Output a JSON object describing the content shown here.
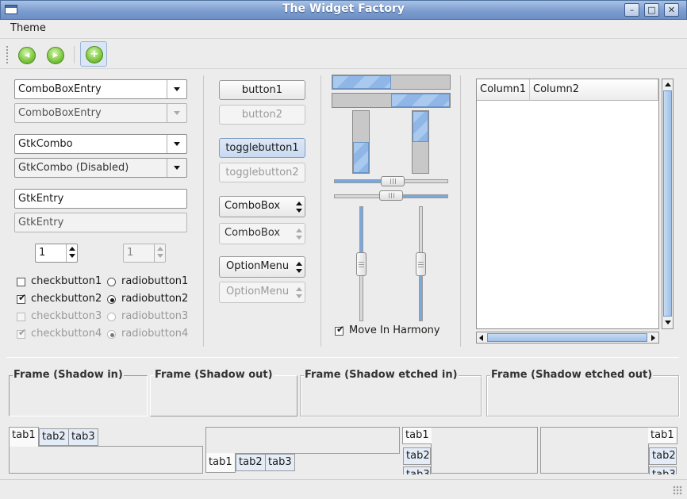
{
  "window": {
    "title": "The Widget Factory",
    "minimize": "–",
    "maximize": "□",
    "close": "✕"
  },
  "menu": {
    "theme": "Theme"
  },
  "toolbar": {
    "back_icon": "back-icon",
    "forward_icon": "forward-icon",
    "add_icon": "add-icon",
    "back_glyph": "◂",
    "forward_glyph": "▸",
    "add_glyph": "+"
  },
  "left": {
    "combo_entry_1": "ComboBoxEntry",
    "combo_entry_2": "ComboBoxEntry",
    "gtkcombo_1": "GtkCombo",
    "gtkcombo_2": "GtkCombo (Disabled)",
    "entry_1": "GtkEntry",
    "entry_2": "GtkEntry",
    "spin_1": "1",
    "spin_2": "1",
    "checks": [
      {
        "label": "checkbutton1",
        "checked": false,
        "disabled": false
      },
      {
        "label": "checkbutton2",
        "checked": true,
        "disabled": false
      },
      {
        "label": "checkbutton3",
        "checked": false,
        "disabled": true
      },
      {
        "label": "checkbutton4",
        "checked": true,
        "disabled": true
      }
    ],
    "radios": [
      {
        "label": "radiobutton1",
        "checked": false,
        "disabled": false
      },
      {
        "label": "radiobutton2",
        "checked": true,
        "disabled": false
      },
      {
        "label": "radiobutton3",
        "checked": false,
        "disabled": true
      },
      {
        "label": "radiobutton4",
        "checked": true,
        "disabled": true
      }
    ]
  },
  "buttons": {
    "button1": "button1",
    "button2": "button2",
    "toggle1": "togglebutton1",
    "toggle2": "togglebutton2",
    "combobox1": "ComboBox",
    "combobox2": "ComboBox",
    "option1": "OptionMenu",
    "option2": "OptionMenu"
  },
  "ranges": {
    "hprogress_1": 0.5,
    "hprogress_2": 0.5,
    "vprogress_1": 0.5,
    "vprogress_2": 0.5,
    "hscale_1": 0.5,
    "hscale_2": 0.5,
    "vscale_1": 0.5,
    "vscale_2": 0.5,
    "move_in_harmony": "Move In Harmony",
    "move_in_harmony_checked": true
  },
  "tree": {
    "columns": [
      "Column1",
      "Column2"
    ]
  },
  "frames": [
    "Frame (Shadow in)",
    "Frame (Shadow out)",
    "Frame (Shadow etched in)",
    "Frame (Shadow etched out)"
  ],
  "notebooks": {
    "tabs": [
      "tab1",
      "tab2",
      "tab3"
    ]
  },
  "colors": {
    "accent": "#8fb6e6",
    "titlebar": "#7d9dcf",
    "background": "#ececec"
  }
}
